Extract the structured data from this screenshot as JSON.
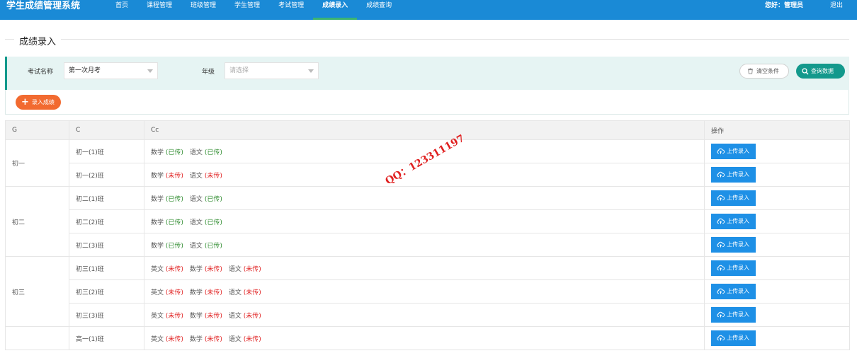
{
  "header": {
    "brand": "学生成绩管理系统",
    "nav": [
      {
        "label": "首页",
        "active": false
      },
      {
        "label": "课程管理",
        "active": false
      },
      {
        "label": "班级管理",
        "active": false
      },
      {
        "label": "学生管理",
        "active": false
      },
      {
        "label": "考试管理",
        "active": false
      },
      {
        "label": "成绩录入",
        "active": true
      },
      {
        "label": "成绩查询",
        "active": false
      }
    ],
    "greeting": "您好：管理员",
    "logout": "退出"
  },
  "page_title": "成绩录入",
  "filters": {
    "exam_label": "考试名称",
    "exam_value": "第一次月考",
    "grade_label": "年级",
    "grade_placeholder": "请选择",
    "clear_button": "清空条件",
    "query_button": "查询数据"
  },
  "add_button": "录入成绩",
  "table": {
    "headers": [
      "G",
      "C",
      "Cc",
      "操作"
    ],
    "action_label": "上传录入",
    "groups": [
      {
        "grade": "初一",
        "rows": [
          {
            "class": "初一(1)班",
            "subjects": [
              {
                "name": "数学",
                "status": "(已传)",
                "uploaded": true
              },
              {
                "name": "语文",
                "status": "(已传)",
                "uploaded": true
              }
            ]
          },
          {
            "class": "初一(2)班",
            "subjects": [
              {
                "name": "数学",
                "status": "(未传)",
                "uploaded": false
              },
              {
                "name": "语文",
                "status": "(未传)",
                "uploaded": false
              }
            ]
          }
        ]
      },
      {
        "grade": "初二",
        "rows": [
          {
            "class": "初二(1)班",
            "subjects": [
              {
                "name": "数学",
                "status": "(已传)",
                "uploaded": true
              },
              {
                "name": "语文",
                "status": "(已传)",
                "uploaded": true
              }
            ]
          },
          {
            "class": "初二(2)班",
            "subjects": [
              {
                "name": "数学",
                "status": "(已传)",
                "uploaded": true
              },
              {
                "name": "语文",
                "status": "(已传)",
                "uploaded": true
              }
            ]
          },
          {
            "class": "初二(3)班",
            "subjects": [
              {
                "name": "数学",
                "status": "(已传)",
                "uploaded": true
              },
              {
                "name": "语文",
                "status": "(已传)",
                "uploaded": true
              }
            ]
          }
        ]
      },
      {
        "grade": "初三",
        "rows": [
          {
            "class": "初三(1)班",
            "subjects": [
              {
                "name": "英文",
                "status": "(未传)",
                "uploaded": false
              },
              {
                "name": "数学",
                "status": "(未传)",
                "uploaded": false
              },
              {
                "name": "语文",
                "status": "(未传)",
                "uploaded": false
              }
            ]
          },
          {
            "class": "初三(2)班",
            "subjects": [
              {
                "name": "英文",
                "status": "(未传)",
                "uploaded": false
              },
              {
                "name": "数学",
                "status": "(未传)",
                "uploaded": false
              },
              {
                "name": "语文",
                "status": "(未传)",
                "uploaded": false
              }
            ]
          },
          {
            "class": "初三(3)班",
            "subjects": [
              {
                "name": "英文",
                "status": "(未传)",
                "uploaded": false
              },
              {
                "name": "数学",
                "status": "(未传)",
                "uploaded": false
              },
              {
                "name": "语文",
                "status": "(未传)",
                "uploaded": false
              }
            ]
          }
        ]
      },
      {
        "grade": "",
        "rows": [
          {
            "class": "高一(1)班",
            "subjects": [
              {
                "name": "英文",
                "status": "(未传)",
                "uploaded": false
              },
              {
                "name": "数学",
                "status": "(未传)",
                "uploaded": false
              },
              {
                "name": "语文",
                "status": "(未传)",
                "uploaded": false
              }
            ]
          }
        ]
      }
    ]
  },
  "watermark": "QQ：123311197",
  "colors": {
    "topbar": "#1a8ad6",
    "teal": "#13998c",
    "orange": "#f26a30",
    "upload": "#1e90e6",
    "uploaded": "#2e8b2e",
    "not_uploaded": "#e02020"
  }
}
